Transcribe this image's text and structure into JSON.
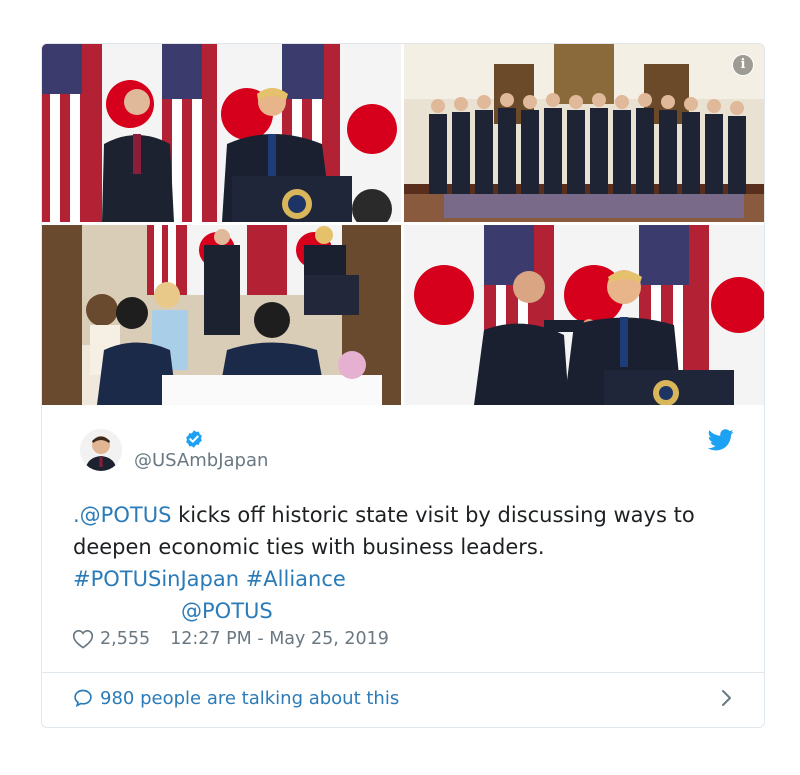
{
  "tweet": {
    "handle": "@USAmbJapan",
    "text_mention": ".@POTUS",
    "text_body": " kicks off historic state visit by discussing ways to deepen economic ties with business leaders.",
    "hashtags": "#POTUSinJapan #Alliance",
    "mention_line": "@POTUS",
    "likes": "2,555",
    "timestamp": "12:27 PM - May 25, 2019",
    "talking_about": "980 people are talking about this"
  },
  "icons": {
    "info": "info-icon",
    "verified": "verified-badge-icon",
    "twitter": "twitter-bird-icon",
    "like": "heart-icon",
    "reply": "speech-bubble-icon",
    "chevron": "chevron-right-icon"
  },
  "colors": {
    "link": "#2b7bb9",
    "muted": "#697882",
    "border": "#e1e8ed",
    "twitter_blue": "#1da1f2"
  }
}
